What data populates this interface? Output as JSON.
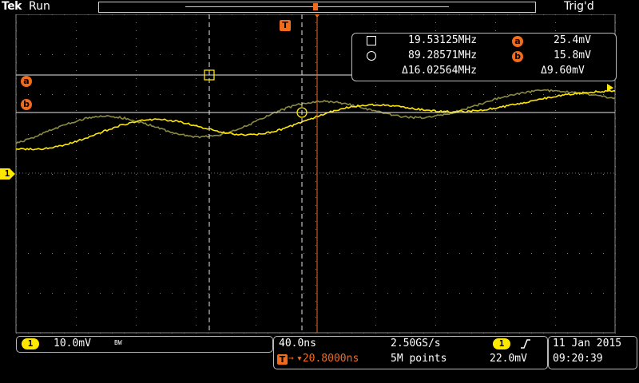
{
  "header": {
    "brand": "Tek",
    "run_state": "Run",
    "trigger_state": "Trig'd"
  },
  "markers": {
    "trigger_marker": "T",
    "cursor_a_label": "a",
    "cursor_b_label": "b",
    "channel1_label": "1"
  },
  "readout": {
    "cursor1_freq": "19.53125MHz",
    "cursor1_level_label": "a",
    "cursor1_level": "25.4mV",
    "cursor2_freq": "89.28571MHz",
    "cursor2_level_label": "b",
    "cursor2_level": "15.8mV",
    "delta_freq": "Δ16.02564MHz",
    "delta_level": "Δ9.60mV"
  },
  "status": {
    "ch1_badge": "1",
    "ch1_scale": "10.0mV",
    "ch1_bw": "BW",
    "timebase": "40.0ns",
    "sample_rate": "2.50GS/s",
    "trigger_position": "▾20.8000ns",
    "record_length": "5M points",
    "trigger_source": "1",
    "trigger_slope_icon": "rising-edge-icon",
    "trigger_level": "22.0mV",
    "date": "11 Jan  2015",
    "time": "09:20:39"
  },
  "colors": {
    "ch1": "#ffe800",
    "reference": "#8a8a45",
    "accent": "#f26a1b",
    "grid": "#bdbdbd"
  }
}
